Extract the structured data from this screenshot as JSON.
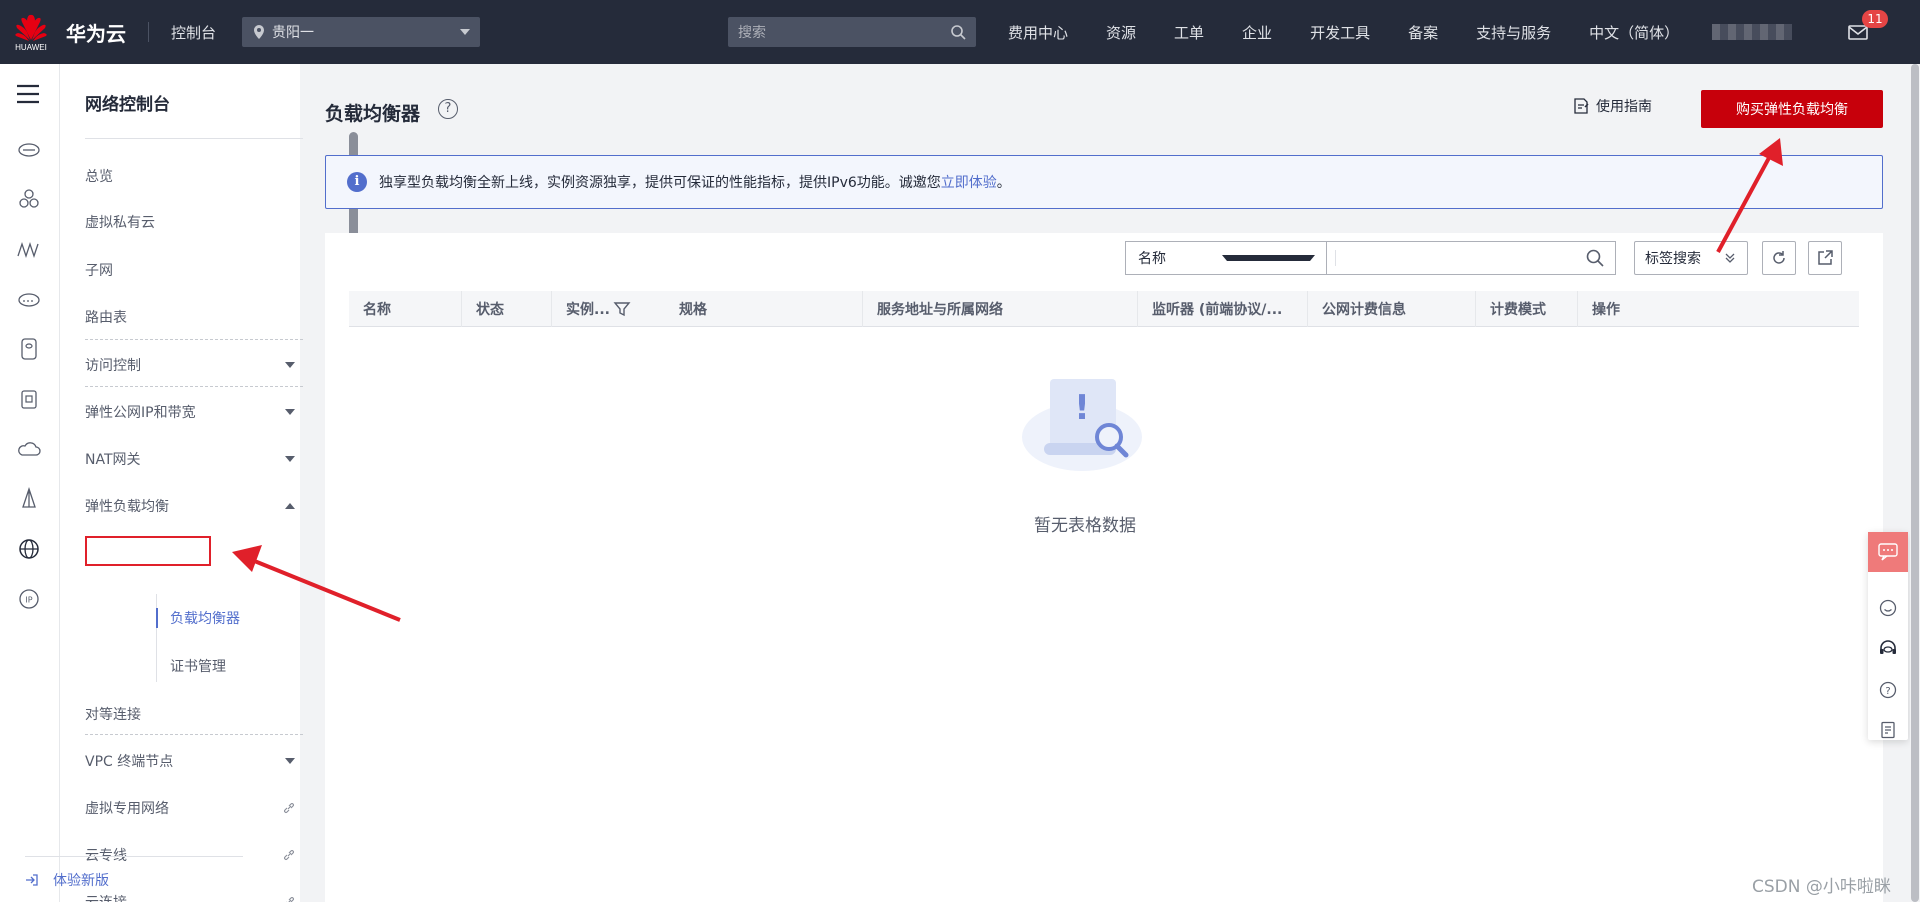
{
  "topbar": {
    "logo_text": "HUAWEI",
    "brand": "华为云",
    "console": "控制台",
    "region": "贵阳一",
    "search_placeholder": "搜索",
    "nav": [
      "费用中心",
      "资源",
      "工单",
      "企业",
      "开发工具",
      "备案",
      "支持与服务",
      "中文（简体）"
    ],
    "mail_badge": "11"
  },
  "sidebar": {
    "title": "网络控制台",
    "items": {
      "overview": "总览",
      "vpc": "虚拟私有云",
      "subnet": "子网",
      "route": "路由表",
      "access": "访问控制",
      "eip": "弹性公网IP和带宽",
      "nat": "NAT网关",
      "elb": "弹性负载均衡",
      "lb": "负载均衡器",
      "cert": "证书管理",
      "peering": "对等连接",
      "vpcep": "VPC 终端节点",
      "vpn": "虚拟专用网络",
      "dc": "云专线",
      "cc": "云连接"
    },
    "new_version": "体验新版"
  },
  "main": {
    "title": "负载均衡器",
    "guide": "使用指南",
    "buy_button": "购买弹性负载均衡",
    "notice_text": "独享型负载均衡全新上线，实例资源独享，提供可保证的性能指标，提供IPv6功能。诚邀您",
    "notice_link": "立即体验",
    "notice_end": "。",
    "filter_select": "名称",
    "tag_search": "标签搜索",
    "columns": [
      "名称",
      "状态",
      "实例...",
      "规格",
      "服务地址与所属网络",
      "监听器 (前端协议/...",
      "公网计费信息",
      "计费模式",
      "操作"
    ],
    "empty_text": "暂无表格数据"
  },
  "watermark": "CSDN @小咔啦眯",
  "colors": {
    "accent": "#526ecc",
    "buy": "#c7000b",
    "topbar": "#252b3a",
    "annotation": "#e0202a"
  }
}
